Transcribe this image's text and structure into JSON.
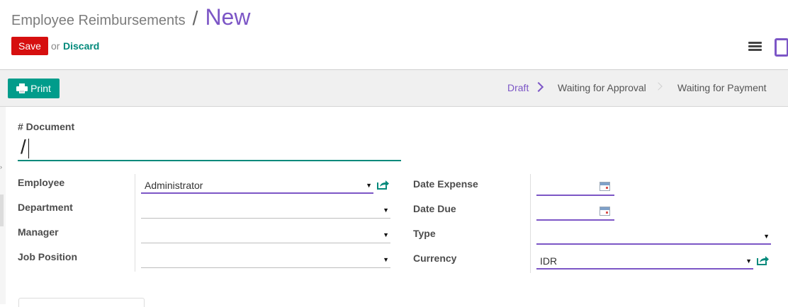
{
  "breadcrumb": {
    "parent": "Employee Reimbursements",
    "separator": "/",
    "current": "New"
  },
  "toolbar": {
    "save_label": "Save",
    "or_text": "or",
    "discard_label": "Discard"
  },
  "statusbar": {
    "print_label": "Print",
    "stages": [
      {
        "label": "Draft",
        "active": true
      },
      {
        "label": "Waiting for Approval",
        "active": false
      },
      {
        "label": "Waiting for Payment",
        "active": false
      }
    ]
  },
  "form": {
    "document_label": "# Document",
    "document_value": "/",
    "left": [
      {
        "label": "Employee",
        "value": "Administrator"
      },
      {
        "label": "Department",
        "value": ""
      },
      {
        "label": "Manager",
        "value": ""
      },
      {
        "label": "Job Position",
        "value": ""
      }
    ],
    "right": [
      {
        "label": "Date Expense",
        "value": ""
      },
      {
        "label": "Date Due",
        "value": ""
      },
      {
        "label": "Type",
        "value": ""
      },
      {
        "label": "Currency",
        "value": "IDR"
      }
    ]
  },
  "icons": {
    "menu": "hamburger-icon",
    "device": "mobile-device-icon",
    "print": "printer-icon",
    "external": "external-link-icon",
    "calendar": "calendar-icon",
    "dropdown": "caret-down-icon"
  },
  "colors": {
    "primary": "#7c56c6",
    "teal": "#00897b",
    "save": "#d60f0f",
    "print": "#019c8b"
  }
}
